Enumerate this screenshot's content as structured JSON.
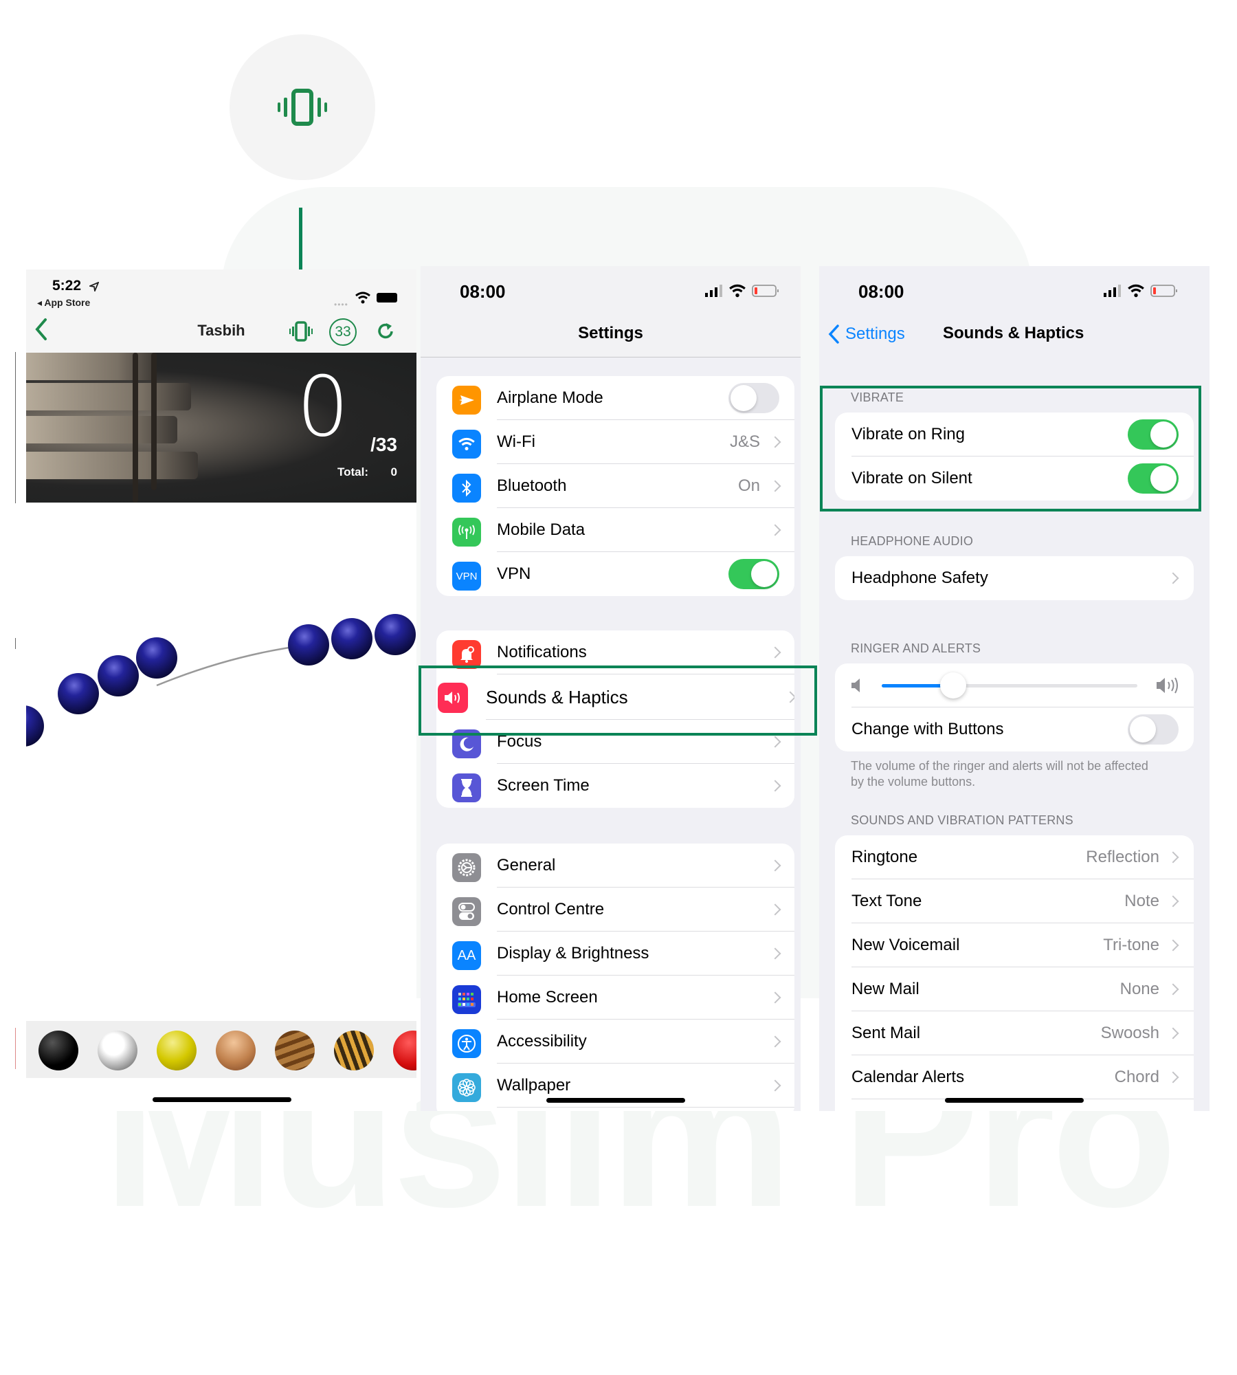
{
  "brand": {
    "accent": "#0b8456",
    "watermark": "Muslim Pro"
  },
  "callout": {
    "icon": "vibrate-icon"
  },
  "tasbih": {
    "status_time": "5:22",
    "back_app": "◂ App Store",
    "title": "Tasbih",
    "target_badge": "33",
    "counter": "0",
    "counter_of": "/33",
    "total_label": "Total:",
    "total_value": "0",
    "bead_options": [
      "black",
      "silver",
      "yellow",
      "copper",
      "wood",
      "tiger-eye",
      "red"
    ]
  },
  "settings": {
    "status_time": "08:00",
    "title": "Settings",
    "groups": [
      [
        {
          "label": "Airplane Mode",
          "icon": "airplane-icon",
          "color": "#ff9500",
          "toggle": false
        },
        {
          "label": "Wi-Fi",
          "icon": "wifi-icon",
          "color": "#0a84ff",
          "value": "J&S"
        },
        {
          "label": "Bluetooth",
          "icon": "bluetooth-icon",
          "color": "#0a84ff",
          "value": "On"
        },
        {
          "label": "Mobile Data",
          "icon": "antenna-icon",
          "color": "#34c759",
          "value": ""
        },
        {
          "label": "VPN",
          "icon": "vpn-icon",
          "color": "#0a84ff",
          "toggle": true,
          "icon_text": "VPN"
        }
      ],
      [
        {
          "label": "Notifications",
          "icon": "bell-icon",
          "color": "#ff3b30"
        },
        {
          "label": "Sounds & Haptics",
          "icon": "speaker-icon",
          "color": "#ff2d55",
          "highlighted": true
        },
        {
          "label": "Focus",
          "icon": "moon-icon",
          "color": "#5856d6"
        },
        {
          "label": "Screen Time",
          "icon": "hourglass-icon",
          "color": "#5856d6"
        }
      ],
      [
        {
          "label": "General",
          "icon": "gear-icon",
          "color": "#8e8e93"
        },
        {
          "label": "Control Centre",
          "icon": "switches-icon",
          "color": "#8e8e93"
        },
        {
          "label": "Display & Brightness",
          "icon": "text-size-icon",
          "color": "#0a84ff",
          "icon_text": "AA"
        },
        {
          "label": "Home Screen",
          "icon": "home-grid-icon",
          "color": "#1a3bd6"
        },
        {
          "label": "Accessibility",
          "icon": "accessibility-icon",
          "color": "#0a84ff"
        },
        {
          "label": "Wallpaper",
          "icon": "flower-icon",
          "color": "#34aadc"
        }
      ]
    ]
  },
  "sounds": {
    "status_time": "08:00",
    "back_label": "Settings",
    "title": "Sounds & Haptics",
    "vibrate_header": "VIBRATE",
    "vibrate_ring": {
      "label": "Vibrate on Ring",
      "on": true
    },
    "vibrate_silent": {
      "label": "Vibrate on Silent",
      "on": true
    },
    "headphone_header": "HEADPHONE AUDIO",
    "headphone_safety": "Headphone Safety",
    "ringer_header": "RINGER AND ALERTS",
    "ringer_volume": 0.28,
    "change_with_buttons": {
      "label": "Change with Buttons",
      "on": false
    },
    "ringer_footer": "The volume of the ringer and alerts will not be affected by the volume buttons.",
    "patterns_header": "SOUNDS AND VIBRATION PATTERNS",
    "patterns": [
      {
        "label": "Ringtone",
        "value": "Reflection"
      },
      {
        "label": "Text Tone",
        "value": "Note"
      },
      {
        "label": "New Voicemail",
        "value": "Tri-tone"
      },
      {
        "label": "New Mail",
        "value": "None"
      },
      {
        "label": "Sent Mail",
        "value": "Swoosh"
      },
      {
        "label": "Calendar Alerts",
        "value": "Chord"
      }
    ]
  }
}
